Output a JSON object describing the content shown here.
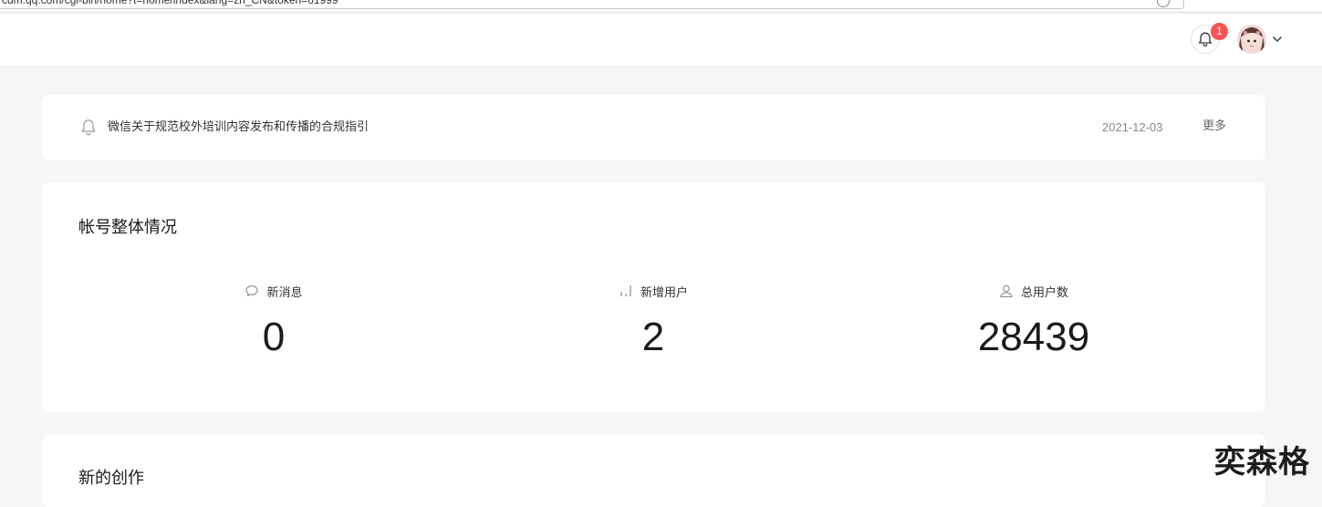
{
  "browser": {
    "url": "cdm.qq.com/cgi-bin/home?t=home/index&lang=zh_CN&token=61999"
  },
  "header": {
    "notification_count": "1"
  },
  "notice": {
    "text": "微信关于规范校外培训内容发布和传播的合规指引",
    "date": "2021-12-03",
    "more_label": "更多"
  },
  "overview": {
    "title": "帐号整体情况",
    "stats": [
      {
        "label": "新消息",
        "value": "0",
        "icon": "chat-bubble-icon"
      },
      {
        "label": "新增用户",
        "value": "2",
        "icon": "bar-chart-icon"
      },
      {
        "label": "总用户数",
        "value": "28439",
        "icon": "user-icon"
      }
    ]
  },
  "creation": {
    "title": "新的创作"
  },
  "watermark": {
    "text": "奕森格"
  },
  "colors": {
    "page_bg": "#f5f6f7",
    "card_bg": "#ffffff",
    "badge": "#fa5151"
  }
}
